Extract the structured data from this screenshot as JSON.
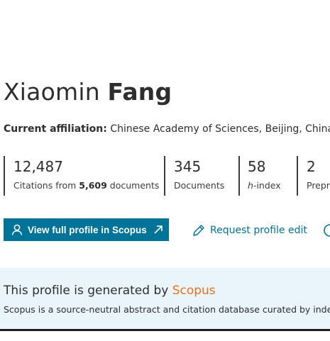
{
  "author": {
    "first_name": "Xiaomin",
    "last_name": "Fang"
  },
  "affiliation": {
    "label": "Current affiliation:",
    "value": "Chinese Academy of Sciences, Beijing, China"
  },
  "metrics": [
    {
      "value": "12,487",
      "label_prefix": "Citations from ",
      "label_bold": "5,609",
      "label_suffix": " documents"
    },
    {
      "value": "345",
      "label": "Documents"
    },
    {
      "value": "58",
      "label_italic": "h",
      "label_suffix": "-index"
    },
    {
      "value": "2",
      "label": "Preprints"
    }
  ],
  "actions": {
    "view_profile_label": "View full profile in Scopus",
    "request_edit_label": "Request profile edit"
  },
  "banner": {
    "title_prefix": "This profile is generated by ",
    "title_brand": "Scopus",
    "description": "Scopus is a source-neutral abstract and citation database curated by independent subject matter experts."
  },
  "colors": {
    "accent": "#007398",
    "brand": "#e9711c",
    "banner_bg": "#eaf5fb"
  },
  "icons": [
    "user-icon",
    "external-link-icon",
    "pencil-icon"
  ]
}
